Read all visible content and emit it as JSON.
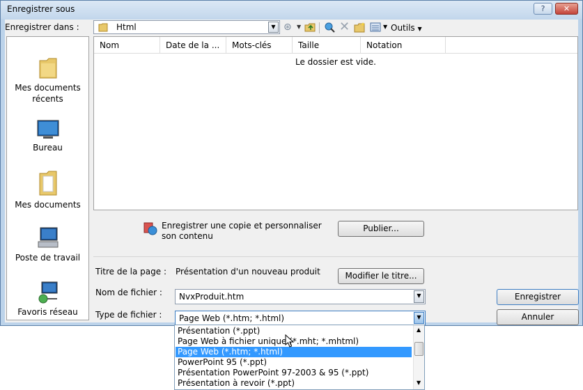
{
  "window": {
    "title": "Enregistrer sous",
    "help_glyph": "?",
    "close_glyph": "✕"
  },
  "location": {
    "label": "Enregistrer dans :",
    "value": "Html"
  },
  "toolbar": {
    "tools_label": "Outils"
  },
  "places": [
    {
      "label": "Mes documents récents",
      "icon": "recent-documents-icon"
    },
    {
      "label": "Bureau",
      "icon": "desktop-icon"
    },
    {
      "label": "Mes documents",
      "icon": "my-documents-icon"
    },
    {
      "label": "Poste de travail",
      "icon": "computer-icon"
    },
    {
      "label": "Favoris réseau",
      "icon": "network-icon"
    }
  ],
  "filelist": {
    "columns": [
      "Nom",
      "Date de la ...",
      "Mots-clés",
      "Taille",
      "Notation"
    ],
    "empty_message": "Le dossier est vide."
  },
  "publish": {
    "text_line1": "Enregistrer une copie et personnaliser",
    "text_line2": "son contenu",
    "button": "Publier..."
  },
  "page_title": {
    "label": "Titre de la page :",
    "value": "Présentation d'un nouveau produit",
    "button": "Modifier le titre..."
  },
  "filename": {
    "label": "Nom de fichier :",
    "value": "NvxProduit.htm"
  },
  "filetype": {
    "label": "Type de fichier :",
    "value": "Page Web (*.htm; *.html)",
    "options": [
      "Présentation (*.ppt)",
      "Page Web à fichier unique (*.mht; *.mhtml)",
      "Page Web (*.htm; *.html)",
      "PowerPoint 95 (*.ppt)",
      "Présentation PowerPoint 97-2003 & 95 (*.ppt)",
      "Présentation à revoir (*.ppt)"
    ],
    "selected_index": 2
  },
  "actions": {
    "save": "Enregistrer",
    "cancel": "Annuler"
  },
  "colors": {
    "selection": "#3399ff",
    "title_bg": "#c3d7ec",
    "close": "#c4443a"
  }
}
